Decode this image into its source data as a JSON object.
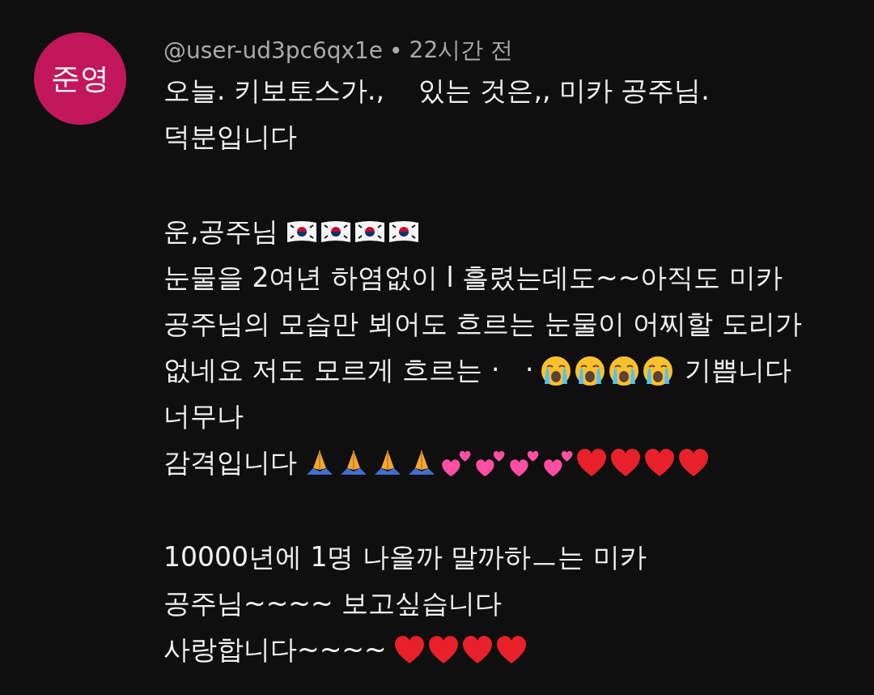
{
  "comment": {
    "avatar": {
      "initials": "준영",
      "color": "#c2185b"
    },
    "author": "@user-ud3pc6qx1e",
    "separator": "•",
    "time": "22시간 전",
    "paragraphs": [
      [
        [
          {
            "kind": "text",
            "text": "오늘. 키보토스가.,    있는 것은,, 미카 공주님."
          }
        ],
        [
          {
            "kind": "text",
            "text": "덕분입니다"
          }
        ]
      ],
      [
        [
          {
            "kind": "text",
            "text": "운,공주님"
          },
          {
            "kind": "flag"
          },
          {
            "kind": "flag"
          },
          {
            "kind": "flag"
          },
          {
            "kind": "flag"
          }
        ],
        [
          {
            "kind": "text",
            "text": "눈물을 2여년 하염없이 l 흘렸는데도~~아직도 미카"
          }
        ],
        [
          {
            "kind": "text",
            "text": "공주님의 모습만 뵈어도 흐르는 눈물이 어찌할 도리가"
          }
        ],
        [
          {
            "kind": "text",
            "text": "없네요 저도 모르게 흐르는 ·   ·"
          },
          {
            "kind": "crying"
          },
          {
            "kind": "crying"
          },
          {
            "kind": "crying"
          },
          {
            "kind": "crying"
          },
          {
            "kind": "text",
            "text": "기쁩니다"
          }
        ],
        [
          {
            "kind": "text",
            "text": "너무나"
          }
        ],
        [
          {
            "kind": "text",
            "text": "감격입니다"
          },
          {
            "kind": "pray"
          },
          {
            "kind": "pray"
          },
          {
            "kind": "pray"
          },
          {
            "kind": "pray"
          },
          {
            "kind": "hearts"
          },
          {
            "kind": "hearts"
          },
          {
            "kind": "hearts"
          },
          {
            "kind": "hearts"
          },
          {
            "kind": "heart"
          },
          {
            "kind": "heart"
          },
          {
            "kind": "heart"
          },
          {
            "kind": "heart"
          }
        ]
      ],
      [
        [
          {
            "kind": "text",
            "text": "10000년에 1명 나올까 말까하ㅡ는 미카"
          }
        ],
        [
          {
            "kind": "text",
            "text": "공주님~~~~ 보고싶습니다"
          }
        ],
        [
          {
            "kind": "text",
            "text": "사랑합니다~~~~"
          },
          {
            "kind": "heart"
          },
          {
            "kind": "heart"
          },
          {
            "kind": "heart"
          },
          {
            "kind": "heart"
          }
        ]
      ]
    ]
  }
}
